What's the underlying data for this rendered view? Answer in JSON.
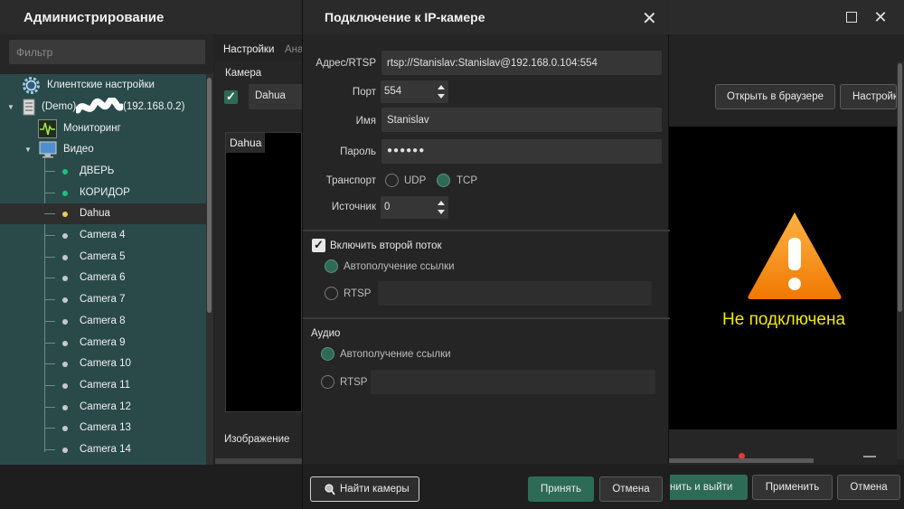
{
  "admin": {
    "title": "Администрирование",
    "filter_placeholder": "Фильтр",
    "tree": {
      "client_settings": "Клиентские настройки",
      "server": "(Demo)",
      "server_ip": "(192.168.0.2)",
      "monitoring": "Мониторинг",
      "video": "Видео",
      "cameras": [
        {
          "label": "ДВЕРЬ",
          "status": "green"
        },
        {
          "label": "КОРИДОР",
          "status": "green"
        },
        {
          "label": "Dahua",
          "status": "yellow"
        },
        {
          "label": "Camera 4",
          "status": "gray"
        },
        {
          "label": "Camera 5",
          "status": "gray"
        },
        {
          "label": "Camera 6",
          "status": "gray"
        },
        {
          "label": "Camera 7",
          "status": "gray"
        },
        {
          "label": "Camera 8",
          "status": "gray"
        },
        {
          "label": "Camera 9",
          "status": "gray"
        },
        {
          "label": "Camera 10",
          "status": "gray"
        },
        {
          "label": "Camera 11",
          "status": "gray"
        },
        {
          "label": "Camera 12",
          "status": "gray"
        },
        {
          "label": "Camera 13",
          "status": "gray"
        },
        {
          "label": "Camera 14",
          "status": "gray"
        }
      ]
    },
    "tabs": {
      "settings": "Настройки",
      "analytics": "Ана"
    },
    "camera_section": "Камера",
    "camera_name": "Dahua",
    "preview_label": "Dahua",
    "image_section": "Изображение",
    "open_browser": "Открыть в браузере",
    "settings_btn": "Настройк",
    "not_connected": "Не подключена",
    "apply_exit": "нить и выйти",
    "apply": "Применить",
    "cancel": "Отмена"
  },
  "dialog": {
    "title": "Подключение к IP-камере",
    "address_label": "Адрес/RTSP",
    "address_value": "rtsp://Stanislav:Stanislav@192.168.0.104:554",
    "port_label": "Порт",
    "port_value": "554",
    "name_label": "Имя",
    "name_value": "Stanislav",
    "password_label": "Пароль",
    "password_value": "●●●●●●",
    "transport_label": "Транспорт",
    "transport_udp": "UDP",
    "transport_tcp": "TCP",
    "source_label": "Источник",
    "source_value": "0",
    "second_stream_label": "Включить второй поток",
    "auto_link": "Автополучение ссылки",
    "rtsp": "RTSP",
    "audio_section": "Аудио",
    "audio_auto_link": "Автополучение ссылки",
    "audio_rtsp": "RTSP",
    "find_cameras": "Найти камеры",
    "accept": "Принять",
    "cancel": "Отмена"
  },
  "colors": {
    "accent": "#2e6b57",
    "tree_bg": "#2a4a4a",
    "warning": "#f0e800"
  }
}
